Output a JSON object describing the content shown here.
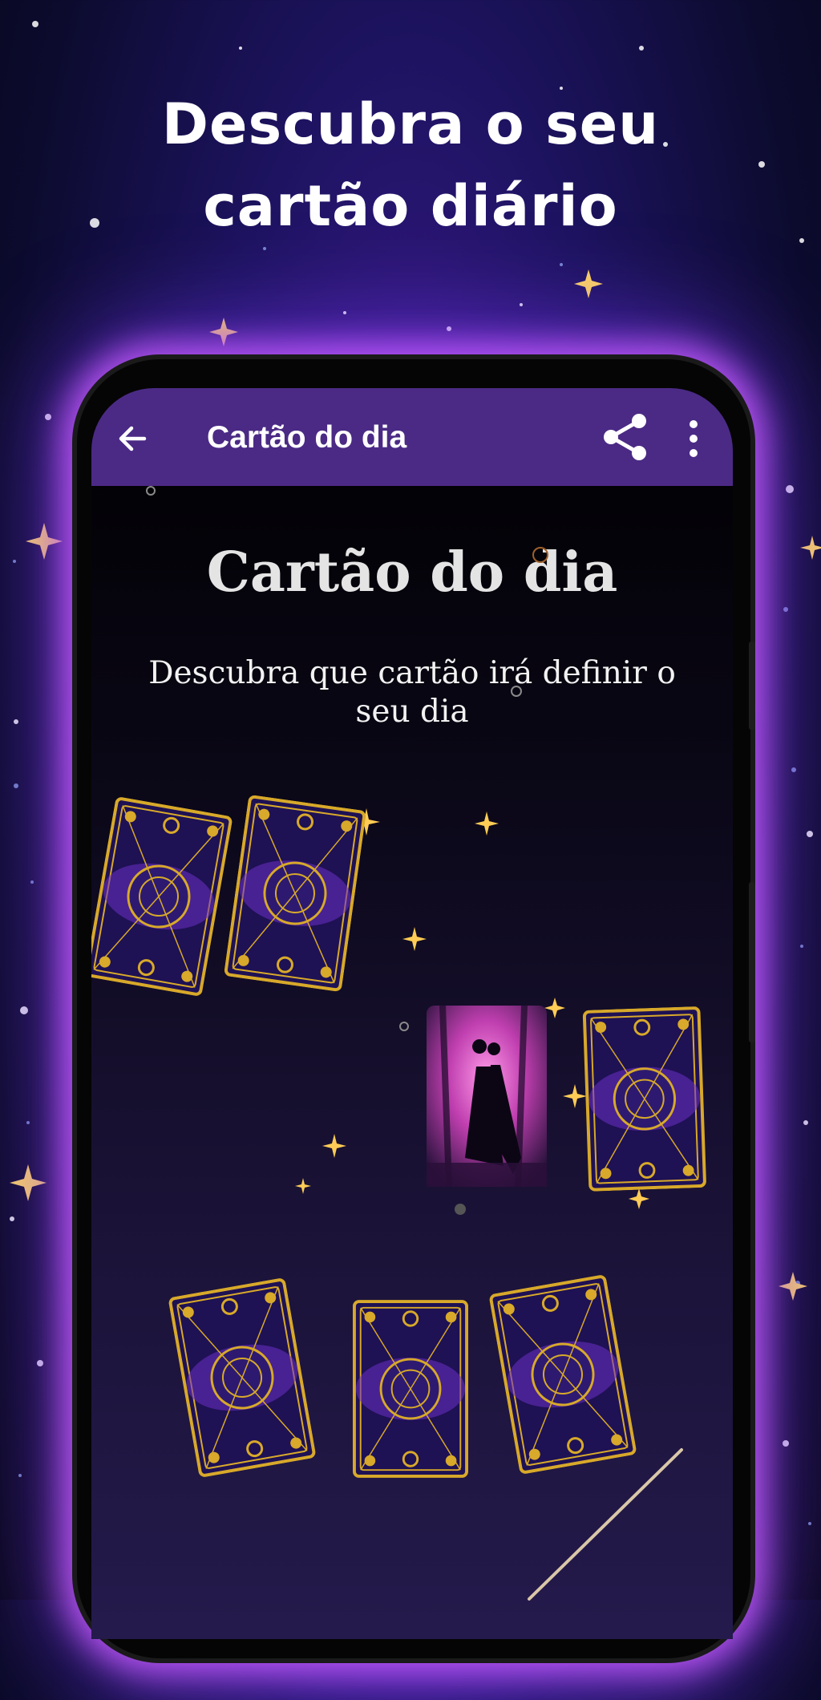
{
  "promo": {
    "title_line1": "Descubra o seu",
    "title_line2": "cartão diário"
  },
  "appbar": {
    "title": "Cartão do dia",
    "back_icon": "arrow-left-icon",
    "share_icon": "share-icon",
    "menu_icon": "more-vert-icon",
    "background": "#4b2a85"
  },
  "content": {
    "heading": "Cartão do dia",
    "subtitle": "Descubra que cartão irá definir o seu dia"
  },
  "cards": {
    "count": 7,
    "revealed_index": 2,
    "back_design": "gold-moon-phase-card-back",
    "revealed_image": "couple-silhouette-pink-forest"
  },
  "colors": {
    "gold": "#d8a92a",
    "purple_glow": "#b34dff",
    "card_purple": "#5a2aa8"
  }
}
